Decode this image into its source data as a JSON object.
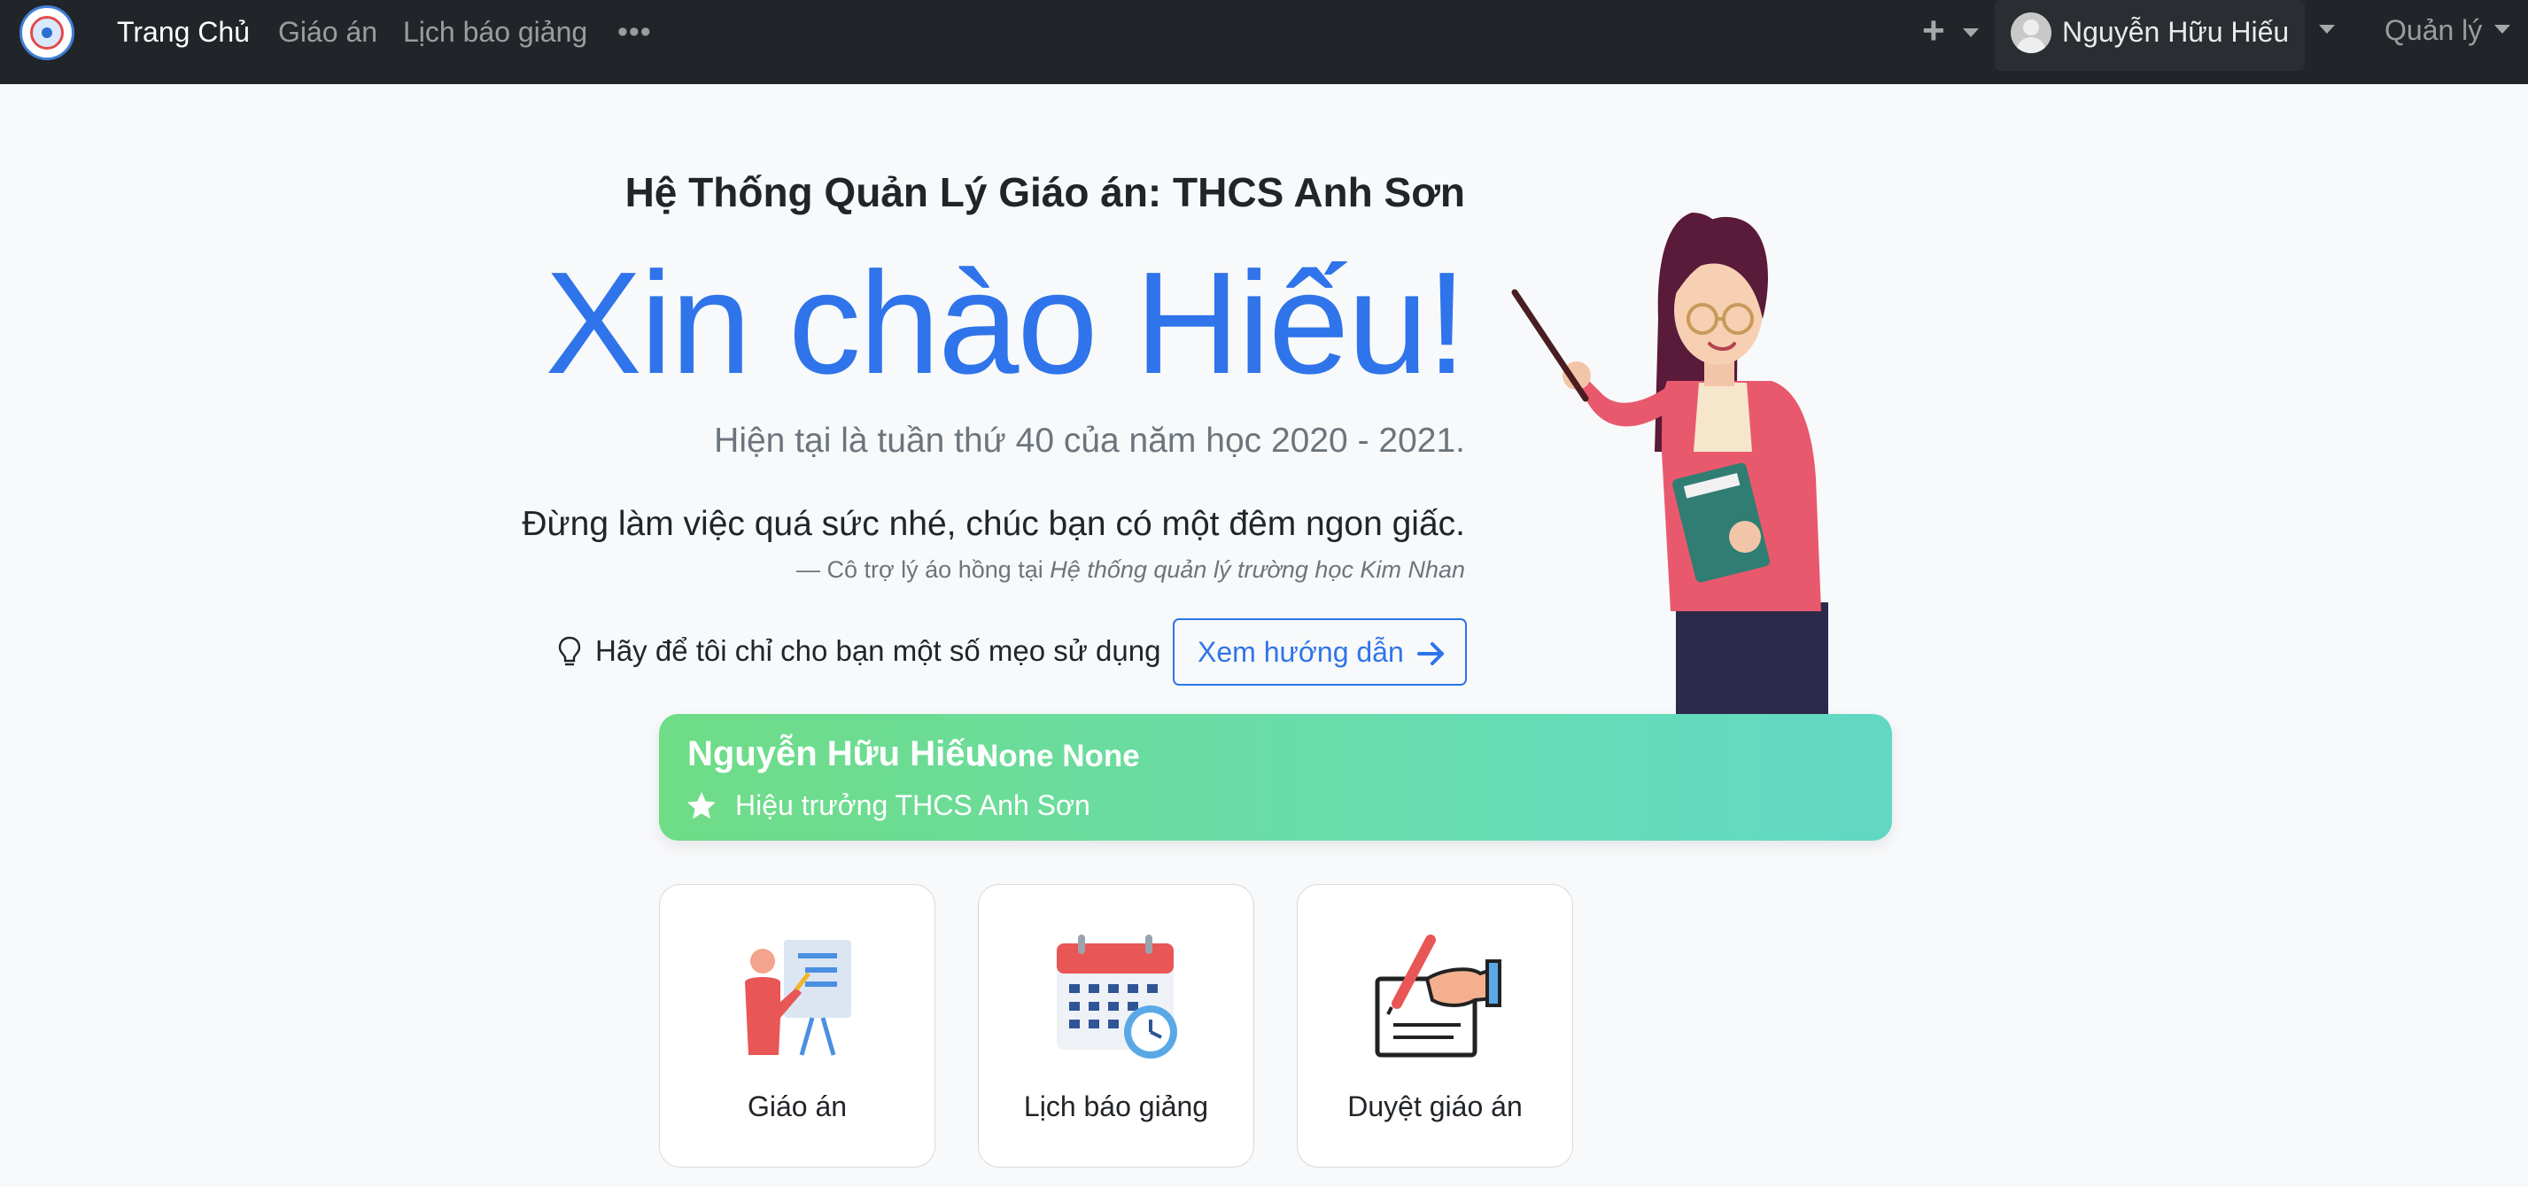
{
  "navbar": {
    "logo_alt": "",
    "links": [
      {
        "label": "Trang Chủ",
        "active": true
      },
      {
        "label": "Giáo án",
        "active": false
      },
      {
        "label": "Lịch báo giảng",
        "active": false
      }
    ],
    "more_label": "•••",
    "add_label": "+",
    "user_name": "Nguyễn Hữu Hiếu",
    "manage_label": "Quản lý"
  },
  "hero": {
    "subtitle": "Hệ Thống Quản Lý Giáo án: THCS Anh Sơn",
    "greeting": "Xin chào Hiếu!",
    "week_text": "Hiện tại là tuần thứ 40 của năm học 2020 - 2021.",
    "quote": "Đừng làm việc quá sức nhé, chúc bạn có một đêm ngon giấc.",
    "quote_source_prefix": "— Cô trợ lý áo hồng tại",
    "quote_source_place": "Hệ thống quản lý trường học Kim Nhan",
    "tip_text": "Hãy để tôi chỉ cho bạn một số mẹo sử dụng",
    "guide_button": "Xem hướng dẫn"
  },
  "profile": {
    "name": "Nguyễn Hữu Hiếu",
    "extra": "None None",
    "role": "Hiệu trưởng THCS Anh Sơn"
  },
  "tiles": [
    {
      "label": "Giáo án",
      "icon": "teacher-board-icon"
    },
    {
      "label": "Lịch báo giảng",
      "icon": "calendar-clock-icon"
    },
    {
      "label": "Duyệt giáo án",
      "icon": "sign-document-icon"
    }
  ],
  "colors": {
    "navbar": "#212529",
    "accent": "#2f74ea",
    "card_gradient_start": "#6fdc86",
    "card_gradient_end": "#62d8c4"
  }
}
